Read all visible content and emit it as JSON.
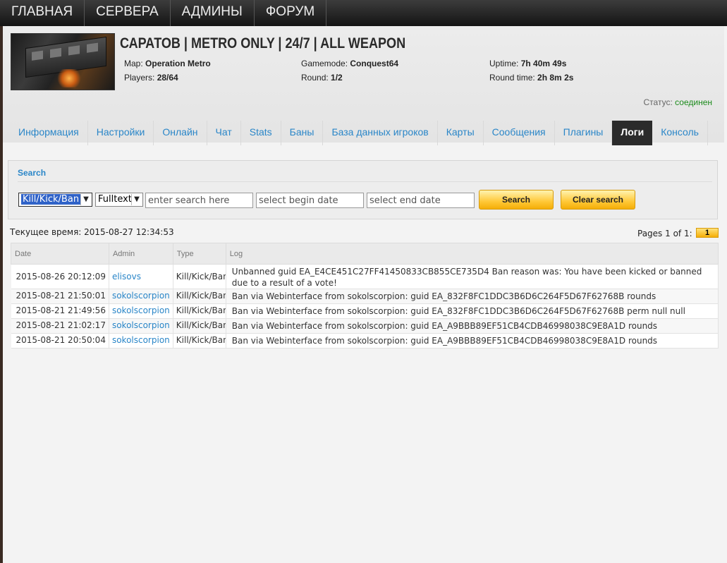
{
  "nav": {
    "items": [
      "ГЛАВНАЯ",
      "СЕРВЕРА",
      "АДМИНЫ",
      "ФОРУМ"
    ]
  },
  "server": {
    "name": "САРАТОВ | METRO ONLY | 24/7 | ALL WEAPON",
    "map_label": "Map:",
    "map_value": "Operation Metro",
    "players_label": "Players:",
    "players_value": "28/64",
    "gamemode_label": "Gamemode:",
    "gamemode_value": "Conquest64",
    "round_label": "Round:",
    "round_value": "1/2",
    "uptime_label": "Uptime:",
    "uptime_value": "7h 40m 49s",
    "roundtime_label": "Round time:",
    "roundtime_value": "2h 8m 2s",
    "status_label": "Статус:",
    "status_value": "соединен",
    "status_color": "#1b8b1b"
  },
  "tabs": [
    "Информация",
    "Настройки",
    "Онлайн",
    "Чат",
    "Stats",
    "Баны",
    "База данных игроков",
    "Карты",
    "Сообщения",
    "Плагины",
    "Логи",
    "Консоль"
  ],
  "active_tab": "Логи",
  "search": {
    "title": "Search",
    "type_select": "Kill/Kick/Ban",
    "mode_select": "Fulltext",
    "query_placeholder": "enter search here",
    "begin_placeholder": "select begin date",
    "end_placeholder": "select end date",
    "search_button": "Search",
    "clear_button": "Clear search"
  },
  "current_time": "Текущее время: 2015-08-27 12:34:53",
  "pagination": {
    "label": "Pages 1 of 1:",
    "current": "1"
  },
  "table": {
    "headers": [
      "Date",
      "Admin",
      "Type",
      "Log"
    ],
    "rows": [
      {
        "date": "2015-08-26 20:12:09",
        "admin": "elisovs",
        "type": "Kill/Kick/Ban",
        "log": "Unbanned guid EA_E4CE451C27FF41450833CB855CE735D4 Ban reason was: You have been kicked or banned due to a result of a vote!"
      },
      {
        "date": "2015-08-21 21:50:01",
        "admin": "sokolscorpion",
        "type": "Kill/Kick/Ban",
        "log": "Ban via Webinterface from sokolscorpion: guid EA_832F8FC1DDC3B6D6C264F5D67F62768B rounds"
      },
      {
        "date": "2015-08-21 21:49:56",
        "admin": "sokolscorpion",
        "type": "Kill/Kick/Ban",
        "log": "Ban via Webinterface from sokolscorpion: guid EA_832F8FC1DDC3B6D6C264F5D67F62768B perm null null"
      },
      {
        "date": "2015-08-21 21:02:17",
        "admin": "sokolscorpion",
        "type": "Kill/Kick/Ban",
        "log": "Ban via Webinterface from sokolscorpion: guid EA_A9BBB89EF51CB4CDB46998038C9E8A1D rounds"
      },
      {
        "date": "2015-08-21 20:50:04",
        "admin": "sokolscorpion",
        "type": "Kill/Kick/Ban",
        "log": "Ban via Webinterface from sokolscorpion: guid EA_A9BBB89EF51CB4CDB46998038C9E8A1D rounds"
      }
    ]
  }
}
